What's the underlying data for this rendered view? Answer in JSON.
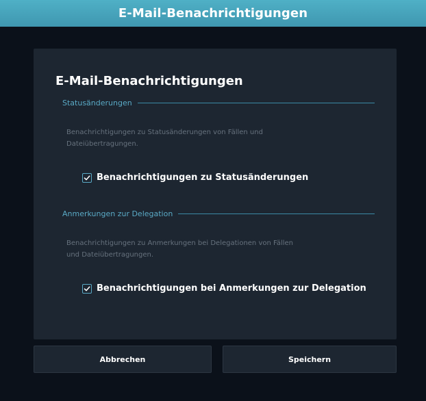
{
  "window": {
    "title": "E-Mail-Benachrichtigungen"
  },
  "panel": {
    "title": "E-Mail-Benachrichtigungen"
  },
  "sections": [
    {
      "header": "Statusänderungen",
      "description": "Benachrichtigungen zu Statusänderungen von Fällen und Dateiübertragungen.",
      "checkbox": {
        "label": "Benachrichtigungen zu Statusänderungen",
        "checked": true
      }
    },
    {
      "header": "Anmerkungen zur Delegation",
      "description": "Benachrichtigungen zu Anmerkungen bei Delegationen von Fällen und Dateiübertragungen.",
      "checkbox": {
        "label": "Benachrichtigungen bei Anmerkungen zur Delegation",
        "checked": true
      }
    }
  ],
  "buttons": {
    "cancel": "Abbrechen",
    "save": "Speichern"
  },
  "colors": {
    "titlebar": "#43a2ba",
    "background": "#0b111a",
    "panel": "#1d2631",
    "accent": "#5aaac6"
  },
  "icons": {
    "checkbox": "checkmark-icon"
  }
}
